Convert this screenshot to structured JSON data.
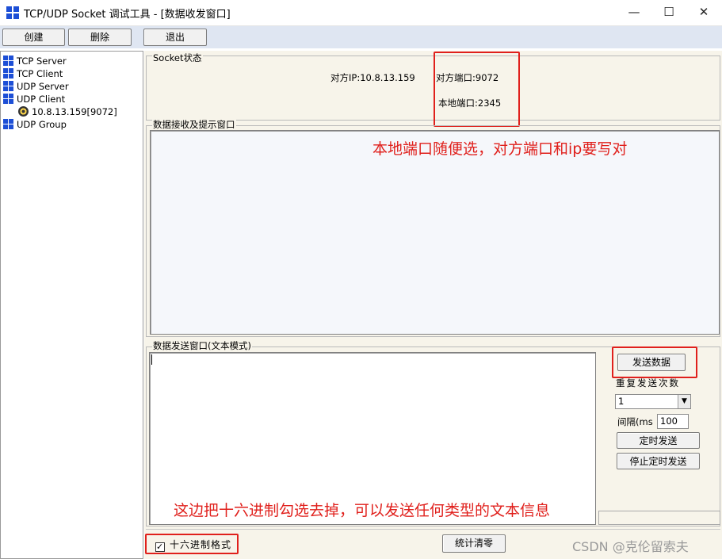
{
  "window": {
    "title": "TCP/UDP Socket 调试工具 - [数据收发窗口]",
    "minimize_glyph": "—",
    "maximize_glyph": "☐",
    "close_glyph": "✕"
  },
  "toolbar": {
    "create_label": "创建",
    "delete_label": "删除",
    "exit_label": "退出"
  },
  "tree": {
    "items": [
      {
        "label": "TCP Server"
      },
      {
        "label": "TCP Client"
      },
      {
        "label": "UDP Server"
      },
      {
        "label": "UDP Client"
      },
      {
        "label": "UDP Group"
      }
    ],
    "udp_client_child": "10.8.13.159[9072]"
  },
  "socket_status": {
    "group_label": "Socket状态",
    "peer_ip": "对方IP:10.8.13.159",
    "peer_port": "对方端口:9072",
    "local_port": "本地端口:2345"
  },
  "receive": {
    "group_label": "数据接收及提示窗口"
  },
  "send": {
    "group_label": "数据发送窗口(文本模式)",
    "send_button": "发送数据",
    "repeat_label": "重复发送次数",
    "repeat_value": "1",
    "interval_label": "间隔(ms",
    "interval_value": "100",
    "timed_send_button": "定时发送",
    "stop_timed_button": "停止定时发送"
  },
  "bottom": {
    "hex_checkbox_label": "十六进制格式",
    "hex_checked": true,
    "hex_check_glyph": "✓",
    "clear_stats_button": "统计清零"
  },
  "annotations": {
    "port_note": "本地端口随便选，对方端口和ip要写对",
    "hex_note": "这边把十六进制勾选去掉，可以发送任何类型的文本信息",
    "accent_color": "#e0201c"
  },
  "watermark": "CSDN @克伦留索夫"
}
